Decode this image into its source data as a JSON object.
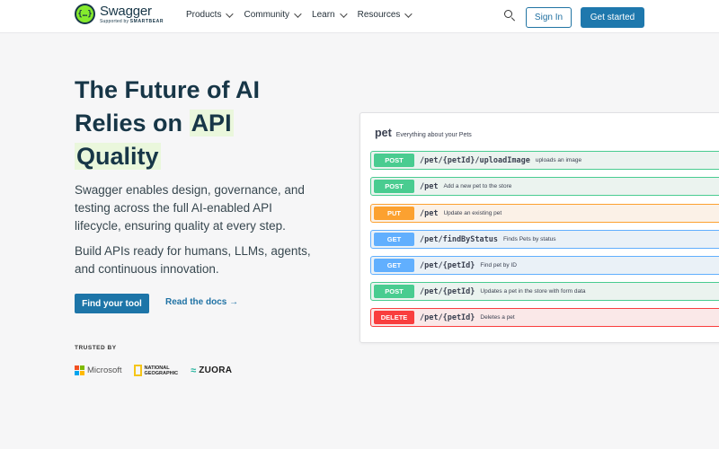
{
  "header": {
    "logo_name": "Swagger",
    "logo_sub_prefix": "Supported by",
    "logo_sub_brand": "SMARTBEAR",
    "logo_mark": "{…}",
    "nav": [
      {
        "label": "Products"
      },
      {
        "label": "Community"
      },
      {
        "label": "Learn"
      },
      {
        "label": "Resources"
      }
    ],
    "sign_in_label": "Sign In",
    "get_started_label": "Get started"
  },
  "hero": {
    "title_line1": "The Future of AI",
    "title_line2_a": "Relies on",
    "title_line2_b": "API",
    "title_line3": "Quality",
    "description": "Swagger enables design, governance, and testing across the full AI-enabled API lifecycle, ensuring quality at every step.",
    "description2": "Build APIs ready for humans, LLMs, agents, and continuous innovation.",
    "find_tool_label": "Find your tool",
    "read_docs_label": "Read the docs →",
    "trusted_label": "TRUSTED BY",
    "logos": {
      "microsoft": "Microsoft",
      "natgeo_line1": "NATIONAL",
      "natgeo_line2": "GEOGRAPHIC",
      "zuora": "ZUORA"
    }
  },
  "api_panel": {
    "tag": "pet",
    "tag_description": "Everything about your Pets",
    "operations": [
      {
        "method": "POST",
        "path": "/pet/{petId}/uploadImage",
        "summary": "uploads an image"
      },
      {
        "method": "POST",
        "path": "/pet",
        "summary": "Add a new pet to the store"
      },
      {
        "method": "PUT",
        "path": "/pet",
        "summary": "Update an existing pet"
      },
      {
        "method": "GET",
        "path": "/pet/findByStatus",
        "summary": "Finds Pets by status"
      },
      {
        "method": "GET",
        "path": "/pet/{petId}",
        "summary": "Find pet by ID"
      },
      {
        "method": "POST",
        "path": "/pet/{petId}",
        "summary": "Updates a pet in the store with form data"
      },
      {
        "method": "DELETE",
        "path": "/pet/{petId}",
        "summary": "Deletes a pet"
      }
    ]
  },
  "colors": {
    "brand_navy": "#173647",
    "brand_green": "#85ea2d",
    "primary_button": "#1e78ad",
    "post": "#49cc90",
    "put": "#fca130",
    "get": "#61affe",
    "delete": "#f93e3e"
  },
  "icons": {
    "search": "search-icon",
    "arrow": "arrow-right-icon"
  }
}
